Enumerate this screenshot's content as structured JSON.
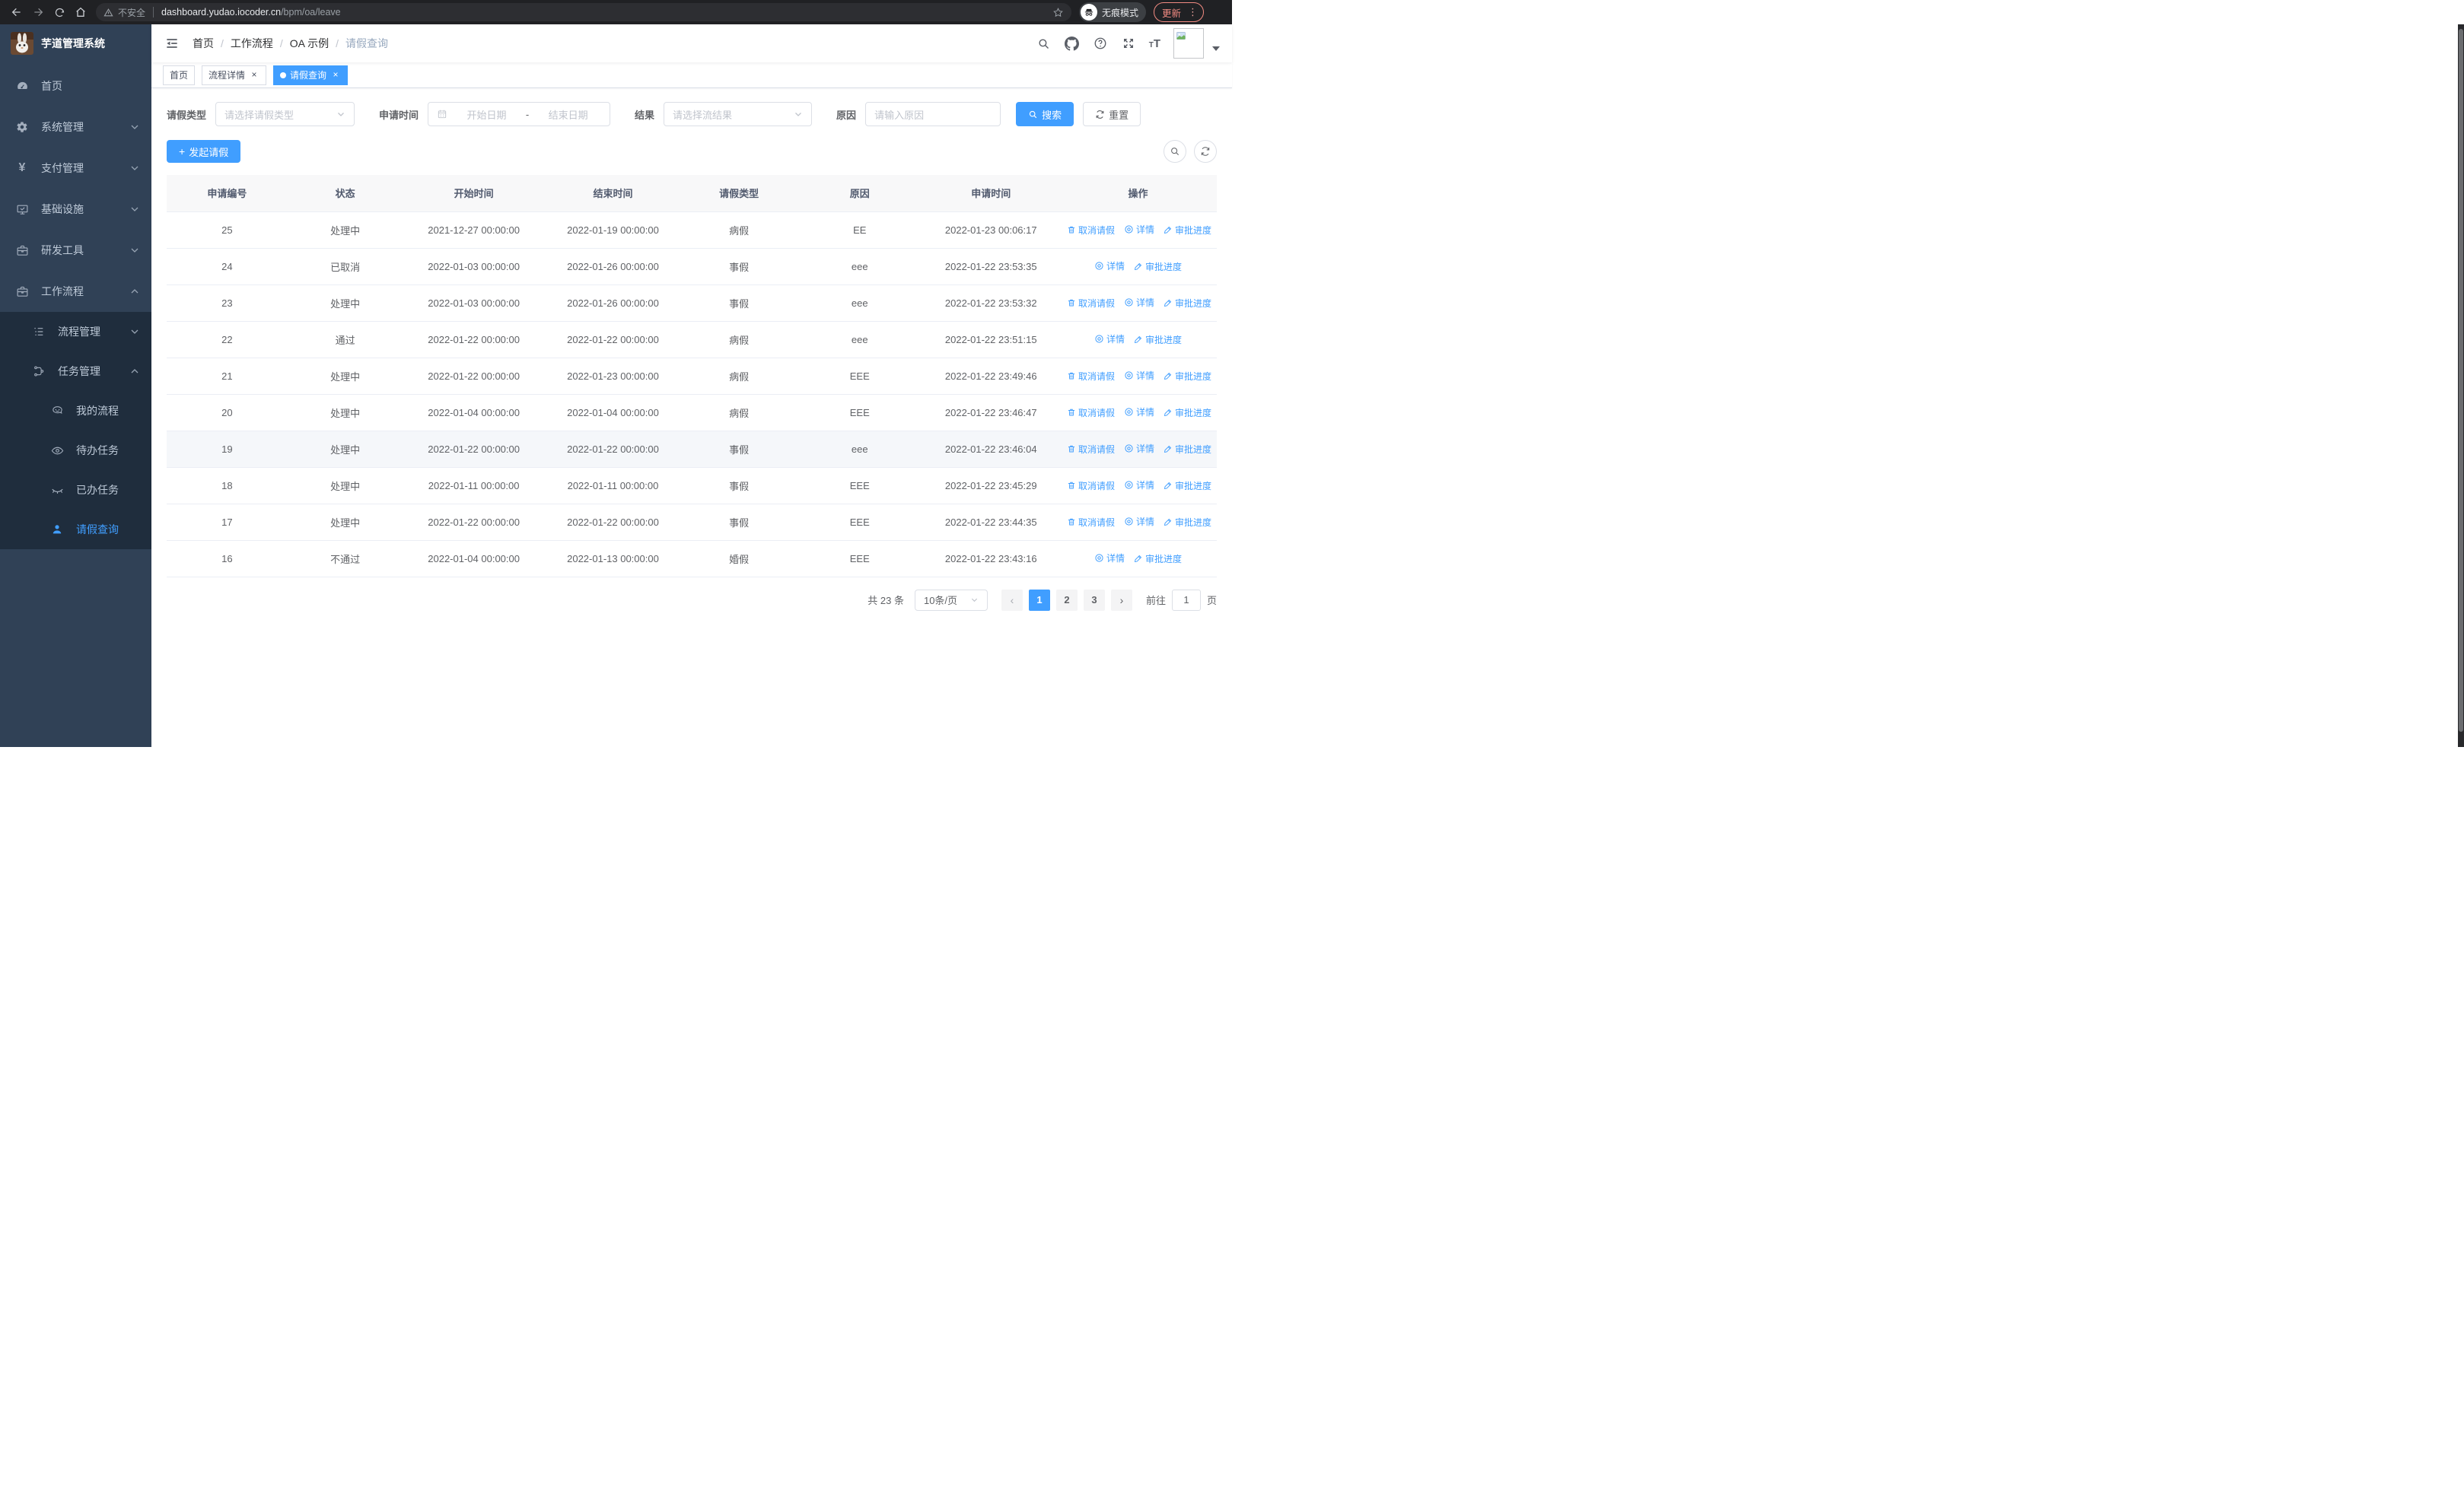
{
  "colors": {
    "accent": "#409eff",
    "sidebar_bg": "#304156",
    "submenu_bg": "#1f2d3d",
    "update_red": "#f28b82",
    "link_blue": "#409eff"
  },
  "browser": {
    "security_label": "不安全",
    "url_host": "dashboard.yudao.iocoder.cn",
    "url_path": "/bpm/oa/leave",
    "incognito_label": "无痕模式",
    "update_label": "更新"
  },
  "sidebar": {
    "title": "芋道管理系统",
    "menu": [
      {
        "name": "home",
        "label": "首页",
        "icon": "dashboard-icon",
        "level": 1
      },
      {
        "name": "system-mgmt",
        "label": "系统管理",
        "icon": "gear-icon",
        "level": 1,
        "chevron": "down"
      },
      {
        "name": "payment-mgmt",
        "label": "支付管理",
        "icon": "yen-icon",
        "level": 1,
        "chevron": "down"
      },
      {
        "name": "infrastructure",
        "label": "基础设施",
        "icon": "monitor-icon",
        "level": 1,
        "chevron": "down"
      },
      {
        "name": "dev-tools",
        "label": "研发工具",
        "icon": "toolbox-icon",
        "level": 1,
        "chevron": "down"
      },
      {
        "name": "workflow",
        "label": "工作流程",
        "icon": "briefcase-icon",
        "level": 1,
        "chevron": "up"
      },
      {
        "name": "process-mgmt",
        "label": "流程管理",
        "icon": "list-icon",
        "level": 2,
        "chevron": "down"
      },
      {
        "name": "task-mgmt",
        "label": "任务管理",
        "icon": "flow-icon",
        "level": 2,
        "chevron": "up"
      },
      {
        "name": "my-process",
        "label": "我的流程",
        "icon": "robot-icon",
        "level": 3
      },
      {
        "name": "todo-tasks",
        "label": "待办任务",
        "icon": "eye-icon",
        "level": 3
      },
      {
        "name": "done-tasks",
        "label": "已办任务",
        "icon": "eye-closed-icon",
        "level": 3
      },
      {
        "name": "leave-query",
        "label": "请假查询",
        "icon": "user-icon",
        "level": 3,
        "active": true
      }
    ]
  },
  "navbar": {
    "separator": "/",
    "breadcrumb": [
      {
        "name": "home",
        "label": "首页"
      },
      {
        "name": "workflow",
        "label": "工作流程"
      },
      {
        "name": "oa-example",
        "label": "OA 示例"
      },
      {
        "name": "leave-query",
        "label": "请假查询",
        "current": true
      }
    ],
    "icons": [
      "search-icon",
      "github-icon",
      "help-icon",
      "fullscreen-icon",
      "font-size-icon"
    ]
  },
  "tabs": [
    {
      "name": "tab-home",
      "label": "首页",
      "closable": false,
      "active": false
    },
    {
      "name": "tab-process-detail",
      "label": "流程详情",
      "closable": true,
      "active": false
    },
    {
      "name": "tab-leave-query",
      "label": "请假查询",
      "closable": true,
      "active": true
    }
  ],
  "filters": {
    "type_label": "请假类型",
    "type_placeholder": "请选择请假类型",
    "time_label": "申请时间",
    "start_placeholder": "开始日期",
    "range_separator": "-",
    "end_placeholder": "结束日期",
    "result_label": "结果",
    "result_placeholder": "请选择流结果",
    "reason_label": "原因",
    "reason_placeholder": "请输入原因",
    "search_label": "搜索",
    "reset_label": "重置"
  },
  "toolbar": {
    "create_label": "发起请假"
  },
  "table": {
    "headers": [
      "申请编号",
      "状态",
      "开始时间",
      "结束时间",
      "请假类型",
      "原因",
      "申请时间",
      "操作"
    ],
    "action_labels": {
      "cancel": "取消请假",
      "detail": "详情",
      "progress": "审批进度"
    },
    "rows": [
      {
        "id": "25",
        "status": "处理中",
        "start": "2021-12-27 00:00:00",
        "end": "2022-01-19 00:00:00",
        "type": "病假",
        "reason": "EE",
        "apply_time": "2022-01-23 00:06:17",
        "actions": [
          "cancel",
          "detail",
          "progress"
        ],
        "hover": false
      },
      {
        "id": "24",
        "status": "已取消",
        "start": "2022-01-03 00:00:00",
        "end": "2022-01-26 00:00:00",
        "type": "事假",
        "reason": "eee",
        "apply_time": "2022-01-22 23:53:35",
        "actions": [
          "detail",
          "progress"
        ],
        "hover": false
      },
      {
        "id": "23",
        "status": "处理中",
        "start": "2022-01-03 00:00:00",
        "end": "2022-01-26 00:00:00",
        "type": "事假",
        "reason": "eee",
        "apply_time": "2022-01-22 23:53:32",
        "actions": [
          "cancel",
          "detail",
          "progress"
        ],
        "hover": false
      },
      {
        "id": "22",
        "status": "通过",
        "start": "2022-01-22 00:00:00",
        "end": "2022-01-22 00:00:00",
        "type": "病假",
        "reason": "eee",
        "apply_time": "2022-01-22 23:51:15",
        "actions": [
          "detail",
          "progress"
        ],
        "hover": false
      },
      {
        "id": "21",
        "status": "处理中",
        "start": "2022-01-22 00:00:00",
        "end": "2022-01-23 00:00:00",
        "type": "病假",
        "reason": "EEE",
        "apply_time": "2022-01-22 23:49:46",
        "actions": [
          "cancel",
          "detail",
          "progress"
        ],
        "hover": false
      },
      {
        "id": "20",
        "status": "处理中",
        "start": "2022-01-04 00:00:00",
        "end": "2022-01-04 00:00:00",
        "type": "病假",
        "reason": "EEE",
        "apply_time": "2022-01-22 23:46:47",
        "actions": [
          "cancel",
          "detail",
          "progress"
        ],
        "hover": false
      },
      {
        "id": "19",
        "status": "处理中",
        "start": "2022-01-22 00:00:00",
        "end": "2022-01-22 00:00:00",
        "type": "事假",
        "reason": "eee",
        "apply_time": "2022-01-22 23:46:04",
        "actions": [
          "cancel",
          "detail",
          "progress"
        ],
        "hover": true
      },
      {
        "id": "18",
        "status": "处理中",
        "start": "2022-01-11 00:00:00",
        "end": "2022-01-11 00:00:00",
        "type": "事假",
        "reason": "EEE",
        "apply_time": "2022-01-22 23:45:29",
        "actions": [
          "cancel",
          "detail",
          "progress"
        ],
        "hover": false
      },
      {
        "id": "17",
        "status": "处理中",
        "start": "2022-01-22 00:00:00",
        "end": "2022-01-22 00:00:00",
        "type": "事假",
        "reason": "EEE",
        "apply_time": "2022-01-22 23:44:35",
        "actions": [
          "cancel",
          "detail",
          "progress"
        ],
        "hover": false
      },
      {
        "id": "16",
        "status": "不通过",
        "start": "2022-01-04 00:00:00",
        "end": "2022-01-13 00:00:00",
        "type": "婚假",
        "reason": "EEE",
        "apply_time": "2022-01-22 23:43:16",
        "actions": [
          "detail",
          "progress"
        ],
        "hover": false
      }
    ]
  },
  "pagination": {
    "total_label": "共 23 条",
    "page_size": "10条/页",
    "pages": [
      "1",
      "2",
      "3"
    ],
    "active_page": "1",
    "goto_label": "前往",
    "goto_value": "1",
    "page_unit": "页"
  }
}
